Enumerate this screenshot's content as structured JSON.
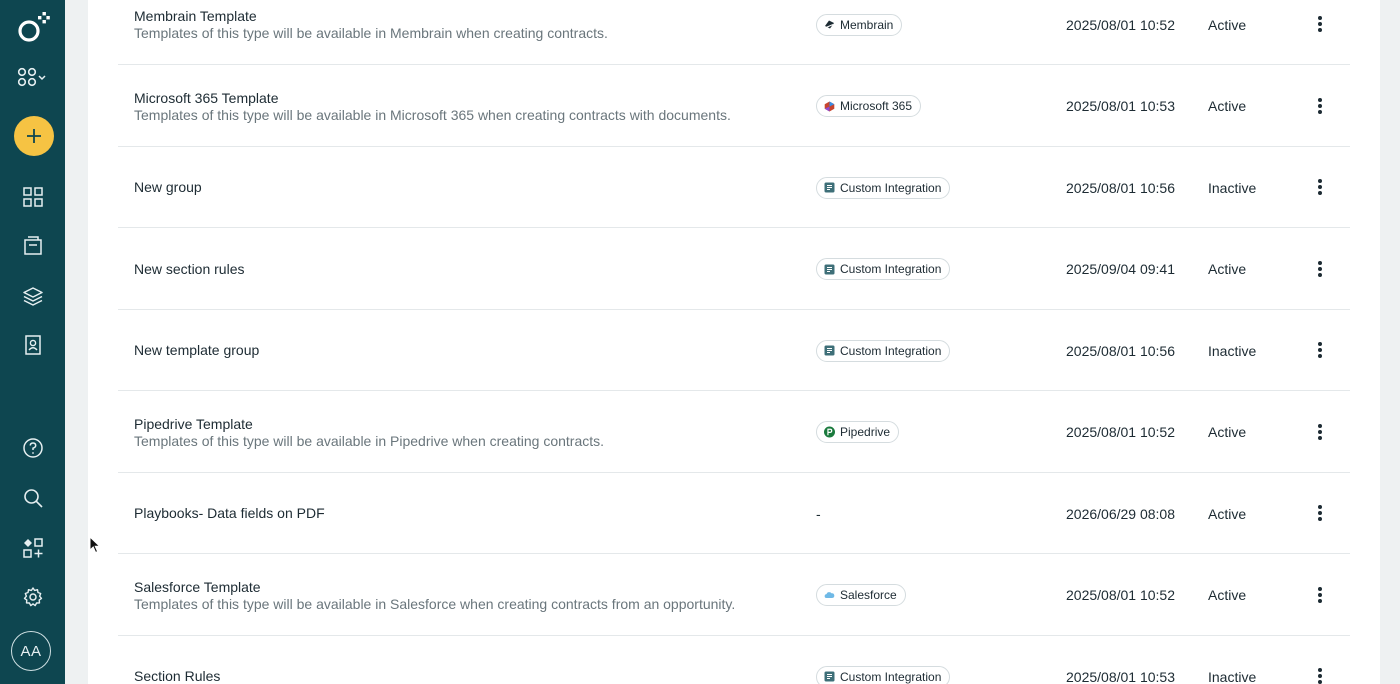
{
  "user": {
    "initials": "AA"
  },
  "colors": {
    "sidebar": "#0e4650",
    "accent": "#f6c343"
  },
  "icons": {
    "logo": "brand-logo-icon",
    "workspace": "workspace-switch-icon",
    "add": "plus-icon",
    "nav": [
      "dashboard-grid-icon",
      "documents-icon",
      "layers-icon",
      "contacts-book-icon"
    ],
    "bottom": [
      "help-icon",
      "search-icon",
      "apps-add-icon",
      "settings-gear-icon"
    ],
    "row_menu": "more-vertical-icon"
  },
  "rows": [
    {
      "name": "Membrain Template",
      "description": "Templates of this type will be available in Membrain when creating contracts.",
      "integration": "Membrain",
      "integration_icon": "membrain-icon",
      "date": "2025/08/01 10:52",
      "status": "Active"
    },
    {
      "name": "Microsoft 365 Template",
      "description": "Templates of this type will be available in Microsoft 365 when creating contracts with documents.",
      "integration": "Microsoft 365",
      "integration_icon": "microsoft-365-icon",
      "date": "2025/08/01 10:53",
      "status": "Active"
    },
    {
      "name": "New group",
      "description": "",
      "integration": "Custom Integration",
      "integration_icon": "custom-integration-icon",
      "date": "2025/08/01 10:56",
      "status": "Inactive"
    },
    {
      "name": "New section rules",
      "description": "",
      "integration": "Custom Integration",
      "integration_icon": "custom-integration-icon",
      "date": "2025/09/04 09:41",
      "status": "Active"
    },
    {
      "name": "New template group",
      "description": "",
      "integration": "Custom Integration",
      "integration_icon": "custom-integration-icon",
      "date": "2025/08/01 10:56",
      "status": "Inactive"
    },
    {
      "name": "Pipedrive Template",
      "description": "Templates of this type will be available in Pipedrive when creating contracts.",
      "integration": "Pipedrive",
      "integration_icon": "pipedrive-icon",
      "date": "2025/08/01 10:52",
      "status": "Active"
    },
    {
      "name": "Playbooks- Data fields on PDF",
      "description": "",
      "integration": "-",
      "integration_icon": "",
      "date": "2026/06/29 08:08",
      "status": "Active"
    },
    {
      "name": "Salesforce Template",
      "description": "Templates of this type will be available in Salesforce when creating contracts from an opportunity.",
      "integration": "Salesforce",
      "integration_icon": "salesforce-icon",
      "date": "2025/08/01 10:52",
      "status": "Active"
    },
    {
      "name": "Section Rules",
      "description": "",
      "integration": "Custom Integration",
      "integration_icon": "custom-integration-icon",
      "date": "2025/08/01 10:53",
      "status": "Inactive"
    }
  ]
}
